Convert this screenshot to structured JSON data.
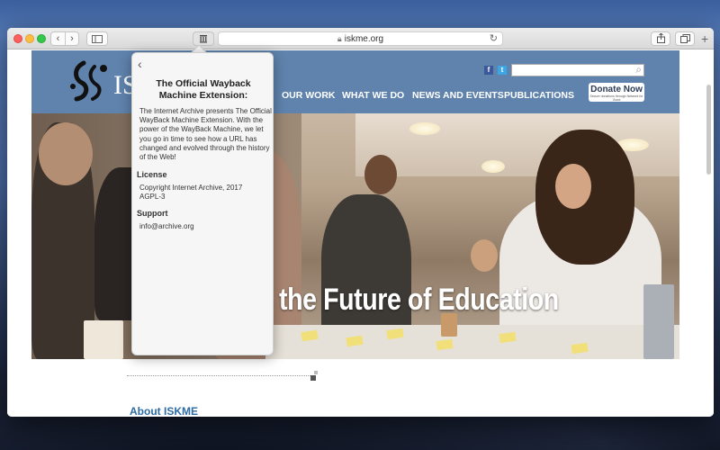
{
  "browser": {
    "address": "iskme.org",
    "nav_back_glyph": "‹",
    "nav_forward_glyph": "›",
    "new_tab_glyph": "+"
  },
  "site": {
    "logo_text": "IS",
    "nav": [
      "OUR WORK",
      "WHAT WE DO",
      "NEWS AND EVENTS",
      "PUBLICATIONS"
    ],
    "donate_label": "Donate Now",
    "donate_tagline": "Secure donations through Network for Good",
    "social_fb": "f",
    "social_tw": "t",
    "hero_title": "the Future of Education",
    "about_heading": "About ISKME"
  },
  "popover": {
    "title": "The Official Wayback Machine Extension:",
    "description": "The Internet Archive presents The Official WayBack Machine Extension. With the power of the WayBack Machine, we let you go in time to see how a URL has changed and evolved through the history of the Web!",
    "license_heading": "License",
    "license_text": "Copyright Internet Archive, 2017 AGPL-3",
    "support_heading": "Support",
    "support_email": "info@archive.org"
  },
  "colors": {
    "header_blue": "#5f83ad",
    "link_blue": "#2d6ba3"
  },
  "icons": [
    "back-icon",
    "forward-icon",
    "sidebar-icon",
    "archive-icon",
    "lock-icon",
    "reload-icon",
    "share-icon",
    "tabs-icon",
    "search-icon",
    "chevron-left-icon"
  ]
}
